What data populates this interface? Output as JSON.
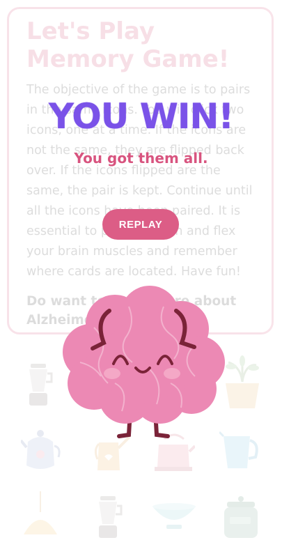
{
  "info": {
    "title": "Let's Play Memory Game!",
    "body": "The objective of the game is to pairs in the same icons. You will click two icons, one at a time. If the icons are not the same, they are flipped back over. If the icons flipped are the same, the pair is kept. Continue until all the icons have been paired. It is essential to pay attention and flex your brain muscles and remember where cards are located. Have fun!",
    "question": "Do want to learn more about Alzheimer's?"
  },
  "win": {
    "title": "YOU WIN!",
    "subtitle": "You got them all.",
    "replay_label": "REPLAY"
  },
  "cards": [
    {
      "icon": "blender-icon",
      "color": "#c7c2c0"
    },
    {
      "icon": "plant-pot-icon",
      "color": "#e8b870"
    },
    {
      "icon": "teapot-icon",
      "color": "#9aaad6"
    },
    {
      "icon": "watering-can-icon",
      "color": "#f0b060"
    },
    {
      "icon": "kettle-icon",
      "color": "#e8889a"
    },
    {
      "icon": "pitcher-icon",
      "color": "#7ec6e6"
    },
    {
      "icon": "lamp-icon",
      "color": "#f5c86a"
    },
    {
      "icon": "blender-icon",
      "color": "#c7c2c0"
    },
    {
      "icon": "bowl-icon",
      "color": "#8fd0d8"
    },
    {
      "icon": "jar-icon",
      "color": "#7aa892"
    }
  ],
  "colors": {
    "accent": "#7a52e8",
    "pink": "#d8547f",
    "brain": "#ec89b4"
  }
}
